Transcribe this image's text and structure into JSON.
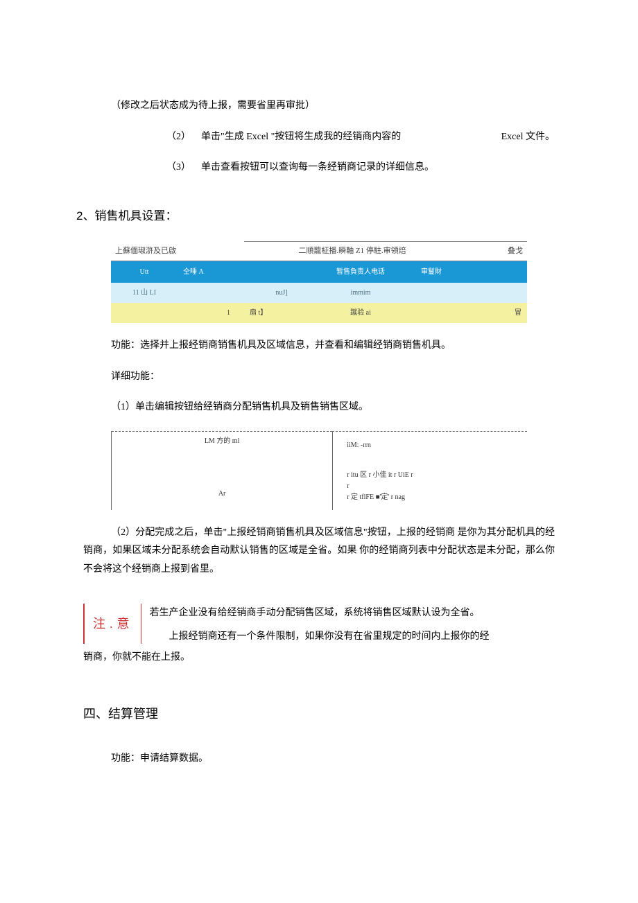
{
  "intro": {
    "p0": "（修改之后状态成为待上报，需要省里再审批）",
    "p1_num": "（2）",
    "p1_a": "单击\"生成 Excel \"按钮将生成我的经销商内容的",
    "p1_b": "Excel 文件。",
    "p2_num": "（3）",
    "p2": "单击查看按钮可以查询每一条经销商记录的详细信息。"
  },
  "section2_title": "2、销售机具设置：",
  "table1": {
    "strip_left": "上蘇偭琡滸及已啟",
    "strip_mid": "二順蘢柾播.瞬軸 Z1 停駐.审領焙",
    "strip_right": "叠戈",
    "head": {
      "c1": "Utt",
      "c2": "仝唾 A",
      "c3": "",
      "c4": "暂售負责人电话",
      "c5": "审鬘財",
      "c6": ""
    },
    "row1": {
      "c1": "11 山 LI",
      "c2": "",
      "c3": "nuJ]",
      "c4": "immim",
      "c5": ""
    },
    "row2": {
      "c1": "",
      "c2": "1",
      "c3": "扇 t】",
      "c4": "蹴验 ai",
      "c5": "",
      "c6": "冒"
    }
  },
  "sec2_para1": "功能：选择并上报经销商销售机具及区域信息，并查看和编辑经销商销售机具。",
  "sec2_para2": "详细功能：",
  "sec2_para3": "（1）单击编辑按钮给经销商分配销售机具及销售销售区域。",
  "diagram": {
    "left_top": "LM 方的 ml",
    "left_mid": "Ar",
    "right_hdr": "iiM:    -rrn",
    "right_l1": "r itu 区 r 小佳 it r UiE r",
    "right_l2": "r",
    "right_l3": "r 定 tflFE ■'定' r nag"
  },
  "sec2_para4": "（2）分配完成之后，单击\"上报经销商销售机具及区域信息\"按钮，上报的经销商 是你为其分配机具的经销商，如果区域未分配系统会自动默认销售的区域是全省。如果 你的经销商列表中分配状态是未分配，那么你不会将这个经销商上报到省里。",
  "note_label": "注.意",
  "note_txt1": "若生产企业没有给经销商手动分配销售区域，系统将销售区域默认设为全省。",
  "note_txt2": "上报经销商还有一个条件限制，如果你没有在省里规定的时间内上报你的经",
  "note_txt3": "销商，你就不能在上报。",
  "section4_title": "四、结算管理",
  "sec4_para1": "功能：申请结算数据。"
}
